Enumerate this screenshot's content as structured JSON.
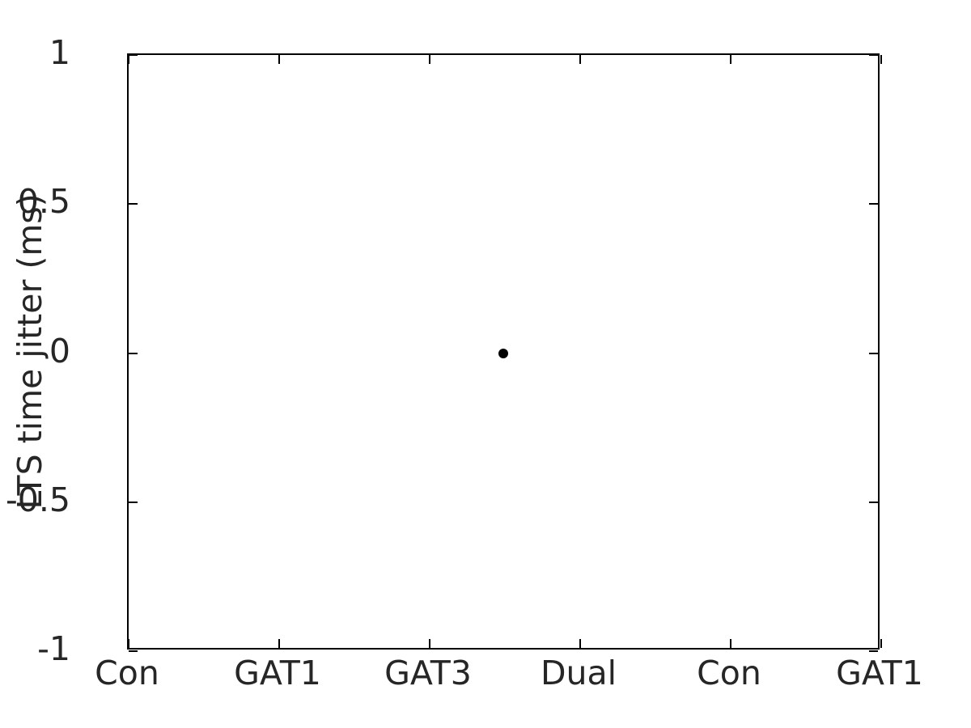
{
  "chart_data": {
    "type": "scatter",
    "title": "",
    "xlabel": "",
    "ylabel": "LTS time jitter (ms)",
    "categories": [
      "Con",
      "GAT1",
      "GAT3",
      "Dual",
      "Con",
      "GAT1"
    ],
    "xtick_labels": [
      "Con",
      "GAT1",
      "GAT3",
      "Dual",
      "Con",
      "GAT1"
    ],
    "xtick_positions": [
      1,
      2,
      3,
      4,
      5,
      6
    ],
    "xlim": [
      1,
      6
    ],
    "ylim": [
      -1,
      1
    ],
    "ytick_labels": [
      "1",
      "0.5",
      "0",
      "-0.5",
      "-1"
    ],
    "ytick_values": [
      1,
      0.5,
      0,
      -0.5,
      -1
    ],
    "grid": false,
    "legend": null,
    "marker_color": "#000000",
    "marker_shape": "circle",
    "axis_color": "#000000",
    "text_color": "#262626",
    "background_color": "#ffffff",
    "series": [
      {
        "name": "LTS time jitter",
        "points": [
          {
            "x": 3.49,
            "y": 0
          }
        ]
      }
    ]
  }
}
